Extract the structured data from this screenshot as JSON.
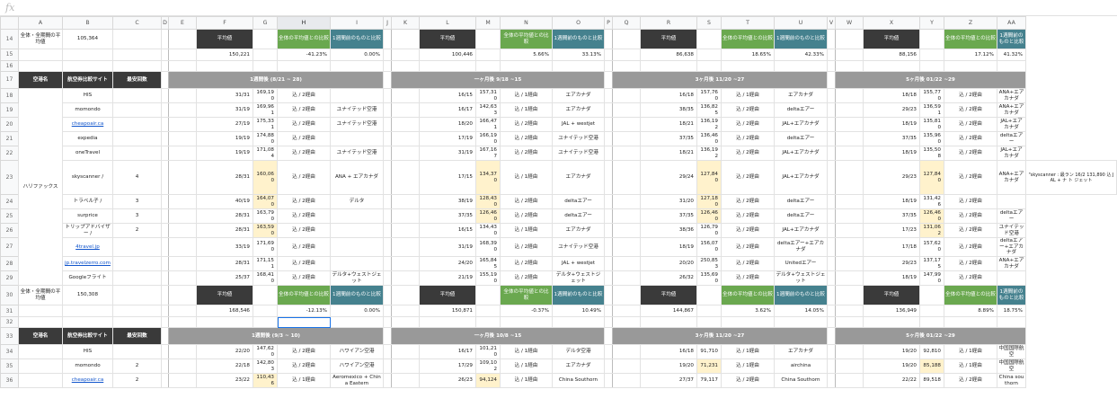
{
  "formula_bar": {
    "symbol": "fx",
    "value": ""
  },
  "columns": [
    "A",
    "B",
    "C",
    "D",
    "E",
    "F",
    "G",
    "H",
    "I",
    "J",
    "K",
    "L",
    "M",
    "N",
    "O",
    "P",
    "Q",
    "R",
    "S",
    "T",
    "U",
    "V",
    "W",
    "X",
    "Y",
    "Z",
    "AA"
  ],
  "header_labels": {
    "avg": "平均値",
    "all_compare": "全体の平均値との比較",
    "week_compare": "1週間前のものと比較",
    "airport": "空港名",
    "site": "航空券比較サイト",
    "min_count": "最安回数"
  },
  "block1": {
    "row14": {
      "label": "全体・全期間の平均値",
      "value": "105,364"
    },
    "row15": {
      "f": "150,221",
      "h": "-41.23%",
      "i": "0.00%",
      "l": "100,446",
      "n": "5.66%",
      "o": "33.13%",
      "r": "86,638",
      "t": "18.65%",
      "u": "42.33%",
      "x": "88,156",
      "z": "17.12%",
      "aa": "41.32%"
    },
    "periods": [
      "1週間後 (8/21 ~ 28)",
      "一ヶ月後 9/18 ~15",
      "3ヶ月後 11/20 ~27",
      "5ヶ月後 01/22 ~29"
    ],
    "airport": "ハリファックス",
    "rows": [
      {
        "n": "18",
        "site": "HIS",
        "link": false,
        "cnt": "",
        "d": [
          [
            "31/31",
            "169,190",
            "込 / 2経由",
            "",
            false
          ],
          [
            "16/15",
            "157,310",
            "込 / 1経由",
            "エアカナダ",
            false
          ],
          [
            "16/18",
            "157,760",
            "込 / 1経由",
            "エアカナダ",
            false
          ],
          [
            "18/18",
            "155,770",
            "込 / 2経由",
            "ANA+エアカナダ",
            false
          ]
        ]
      },
      {
        "n": "19",
        "site": "momondo",
        "link": false,
        "cnt": "",
        "d": [
          [
            "31/19",
            "169,961",
            "込 / 2経由",
            "ユナイテッド空港",
            false
          ],
          [
            "16/17",
            "142,633",
            "込 / 1経由",
            "エアカナダ",
            false
          ],
          [
            "38/35",
            "136,825",
            "込 / 2経由",
            "deltaエアー",
            false
          ],
          [
            "29/23",
            "136,591",
            "込 / 2経由",
            "ANA+エアカナダ",
            false
          ]
        ]
      },
      {
        "n": "20",
        "site": "cheapoair.ca",
        "link": true,
        "cnt": "",
        "d": [
          [
            "27/19",
            "175,331",
            "込 / 2経由",
            "ユナイテッド空港",
            false
          ],
          [
            "18/20",
            "166,471",
            "込 / 2経由",
            "JAL + westjet",
            false
          ],
          [
            "18/21",
            "136,192",
            "込 / 2経由",
            "JAL+エアカナダ",
            false
          ],
          [
            "18/19",
            "135,810",
            "込 / 2経由",
            "JAL+エアカナダ",
            false
          ]
        ]
      },
      {
        "n": "21",
        "site": "expedia",
        "link": false,
        "cnt": "",
        "d": [
          [
            "19/19",
            "174,880",
            "込 / 2経由",
            "",
            false
          ],
          [
            "17/19",
            "166,190",
            "込 / 2経由",
            "ユナイテッド空港",
            false
          ],
          [
            "37/35",
            "136,460",
            "込 / 2経由",
            "deltaエアー",
            false
          ],
          [
            "37/35",
            "135,960",
            "込 / 2経由",
            "deltaエアー",
            false
          ]
        ]
      },
      {
        "n": "22",
        "site": "oneTravel",
        "link": false,
        "cnt": "",
        "d": [
          [
            "19/19",
            "171,084",
            "込 / 2経由",
            "ユナイテッド空港",
            false
          ],
          [
            "31/19",
            "167,167",
            "込 / 2経由",
            "ユナイテッド空港",
            false
          ],
          [
            "18/21",
            "136,192",
            "込 / 2経由",
            "JAL+エアカナダ",
            false
          ],
          [
            "18/19",
            "135,508",
            "込 / 2経由",
            "JAL+エアカナダ",
            false
          ]
        ]
      },
      {
        "n": "23",
        "site": "skyscanner /",
        "link": false,
        "cnt": "4",
        "tall": true,
        "d": [
          [
            "28/31",
            "160,060",
            "込 / 2経由",
            "ANA + エアカナダ",
            true
          ],
          [
            "17/15",
            "134,370",
            "込 / 1経由",
            "エアカナダ",
            true
          ],
          [
            "29/24",
            "127,840",
            "込 / 2経由",
            "JAL+エアカナダ",
            true
          ],
          [
            "29/23",
            "127,840",
            "込 / 2経由",
            "ANA+エアカナダ",
            true
          ]
        ],
        "aa": "\"skyscanner : 最ラン 16/2 131,890 込 JAL + ナ ト ジェット"
      },
      {
        "n": "24",
        "site": "トラベル子 /",
        "link": false,
        "cnt": "3",
        "d": [
          [
            "40/19",
            "164,070",
            "込 / 2経由",
            "デルタ",
            true
          ],
          [
            "38/19",
            "128,430",
            "込 / 2経由",
            "deltaエアー",
            true
          ],
          [
            "31/20",
            "127,180",
            "込 / 2経由",
            "deltaエアー",
            true
          ],
          [
            "18/19",
            "131,426",
            "込 / 2経由",
            "",
            false
          ]
        ]
      },
      {
        "n": "25",
        "site": "surprice",
        "link": false,
        "cnt": "3",
        "d": [
          [
            "28/31",
            "163,790",
            "込 / 2経由",
            "",
            false
          ],
          [
            "37/35",
            "126,460",
            "込 / 2経由",
            "deltaエアー",
            true
          ],
          [
            "37/35",
            "126,460",
            "込 / 2経由",
            "deltaエアー",
            true
          ],
          [
            "37/35",
            "126,460",
            "込 / 2経由",
            "deltaエアー",
            true
          ]
        ]
      },
      {
        "n": "26",
        "site": "トリップアドバイザー /",
        "link": false,
        "cnt": "2",
        "d": [
          [
            "28/31",
            "163,590",
            "込 / 2経由",
            "",
            true
          ],
          [
            "16/15",
            "134,430",
            "込 / 1経由",
            "エアカナダ",
            false
          ],
          [
            "38/36",
            "126,790",
            "込 / 2経由",
            "JAL+エアカナダ",
            false
          ],
          [
            "17/23",
            "131,062",
            "込 / 2経由",
            "ユナイテッド空港",
            true
          ]
        ]
      },
      {
        "n": "27",
        "site": "4travel.jp",
        "link": true,
        "cnt": "",
        "d": [
          [
            "33/19",
            "171,690",
            "込 / 2経由",
            "",
            false
          ],
          [
            "31/19",
            "168,390",
            "込 / 2経由",
            "ユナイテッド空港",
            false
          ],
          [
            "18/19",
            "156,070",
            "込 / 2経由",
            "deltaエアー+エアカナダ",
            false
          ],
          [
            "17/18",
            "157,620",
            "込 / 2経由",
            "deltaエアー+エアカナダ",
            false
          ]
        ]
      },
      {
        "n": "28",
        "site": "jp.travelzerro.com",
        "link": true,
        "cnt": "",
        "d": [
          [
            "28/31",
            "171,151",
            "込 / 2経由",
            "",
            false
          ],
          [
            "24/20",
            "165,845",
            "込 / 2経由",
            "JAL + westjet",
            false
          ],
          [
            "20/20",
            "250,853",
            "込 / 2経由",
            "Unitedエアー",
            false
          ],
          [
            "29/23",
            "137,175",
            "込 / 2経由",
            "ANA+エアカナダ",
            false
          ]
        ]
      },
      {
        "n": "29",
        "site": "Googleフライト",
        "link": false,
        "cnt": "",
        "d": [
          [
            "25/37",
            "168,410",
            "込 / 2経由",
            "デルタ+ウェストジェット",
            false
          ],
          [
            "21/19",
            "155,190",
            "込 / 2経由",
            "デルタ+ウェストジェット",
            false
          ],
          [
            "26/32",
            "135,690",
            "込 / 2経由",
            "デルタ+ウェストジェット",
            false
          ],
          [
            "18/19",
            "147,990",
            "込 / 2経由",
            "",
            false
          ]
        ]
      }
    ],
    "row30": {
      "label": "全体・全期間の平均値",
      "value": "150,308"
    },
    "row31": {
      "f": "168,546",
      "h": "-12.13%",
      "i": "0.00%",
      "l": "150,871",
      "n": "-0.37%",
      "o": "10.49%",
      "r": "144,867",
      "t": "3.62%",
      "u": "14.05%",
      "x": "136,949",
      "z": "8.89%",
      "aa": "18.75%"
    }
  },
  "block2": {
    "periods": [
      "1週間後 (9/3 ~ 10)",
      "一ヶ月後 10/8 ~15",
      "3ヶ月後 11/20 ~27",
      "5ヶ月後 01/22 ~29"
    ],
    "rows": [
      {
        "n": "34",
        "site": "HIS",
        "link": false,
        "cnt": "",
        "d": [
          [
            "22/20",
            "147,620",
            "込 / 2経由",
            "ハワイアン空港",
            false
          ],
          [
            "16/17",
            "101,210",
            "込 / 1経由",
            "デルタ空港",
            false
          ],
          [
            "16/18",
            "91,710",
            "込 / 1経由",
            "エアカナダ",
            false
          ],
          [
            "19/20",
            "92,810",
            "込 / 1経由",
            "中国国際航空",
            false
          ]
        ]
      },
      {
        "n": "35",
        "site": "momondo",
        "link": false,
        "cnt": "2",
        "d": [
          [
            "22/18",
            "142,803",
            "込 / 2経由",
            "ハワイアン空港",
            false
          ],
          [
            "17/29",
            "109,102",
            "込 / 1経由",
            "エアカナダ",
            false
          ],
          [
            "19/20",
            "71,231",
            "込 / 1経由",
            "airchina",
            true
          ],
          [
            "19/20",
            "85,188",
            "込 / 1経由",
            "中国国際航空",
            true
          ]
        ]
      },
      {
        "n": "36",
        "site": "cheapoair.ca",
        "link": true,
        "cnt": "2",
        "d": [
          [
            "23/22",
            "110,436",
            "込 / 1経由",
            "Aeromexico + China Eastern",
            true
          ],
          [
            "26/23",
            "94,124",
            "込 / 1経由",
            "China Southorn",
            true
          ],
          [
            "27/37",
            "79,117",
            "込 / 2経由",
            "China Southorn",
            false
          ],
          [
            "22/22",
            "89,518",
            "込 / 2経由",
            "China southorn",
            false
          ]
        ]
      }
    ]
  }
}
